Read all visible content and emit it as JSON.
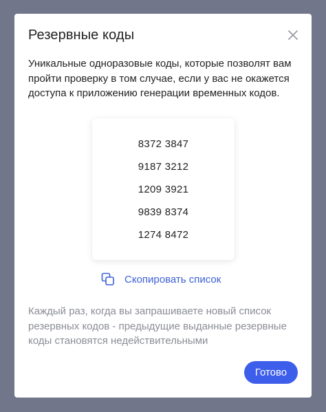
{
  "modal": {
    "title": "Резервные коды",
    "close_icon": "close-icon",
    "description": "Уникальные одноразовые коды, которые позволят вам пройти проверку в том случае, если у вас не окажется доступа к приложению генерации временных кодов.",
    "codes": [
      "8372 3847",
      "9187 3212",
      "1209 3921",
      "9839 8374",
      "1274 8472"
    ],
    "copy": {
      "icon": "copy-icon",
      "label": "Скопировать список"
    },
    "note": "Каждый раз, когда вы запрашиваете новый список резервных кодов - предыдущие выданные резервные коды становятся недействительными",
    "done_label": "Готово"
  },
  "colors": {
    "backdrop": "#71768a",
    "accent": "#3d5eea",
    "link": "#3b5fd8",
    "muted_text": "#8a8d95"
  }
}
